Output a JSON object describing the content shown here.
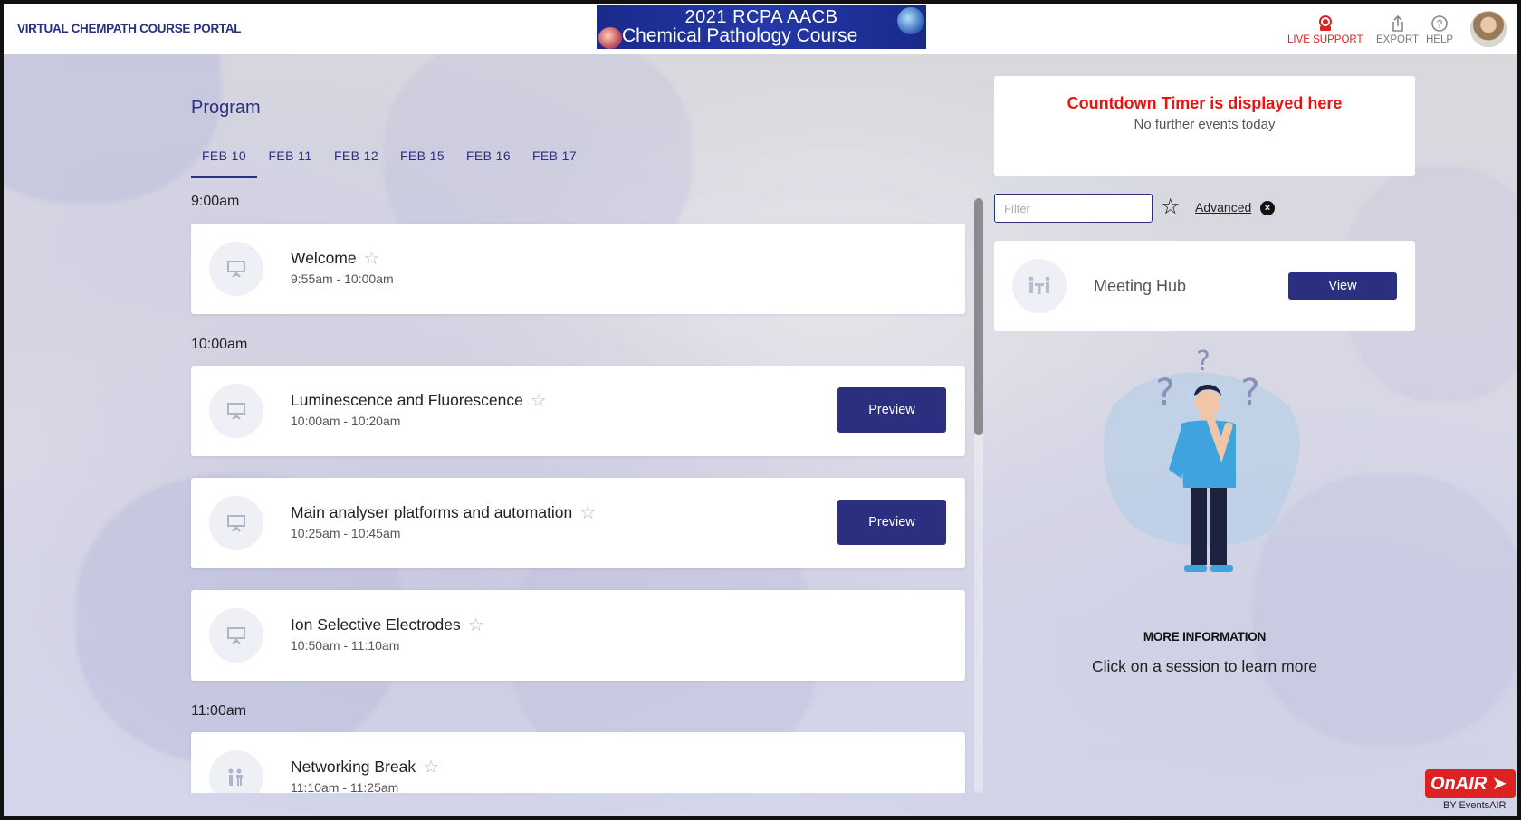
{
  "header": {
    "portal_title": "VIRTUAL CHEMPATH COURSE PORTAL",
    "banner_line1": "2021 RCPA AACB",
    "banner_line2": "Chemical Pathology Course",
    "live_support": "LIVE SUPPORT",
    "export": "EXPORT",
    "help": "HELP"
  },
  "program": {
    "title": "Program",
    "tabs": [
      {
        "label": "FEB 10",
        "active": true
      },
      {
        "label": "FEB 11",
        "active": false
      },
      {
        "label": "FEB 12",
        "active": false
      },
      {
        "label": "FEB 15",
        "active": false
      },
      {
        "label": "FEB 16",
        "active": false
      },
      {
        "label": "FEB 17",
        "active": false
      }
    ],
    "time_groups": [
      "9:00am",
      "10:00am",
      "11:00am"
    ],
    "sessions": [
      {
        "title": "Welcome",
        "times": "9:55am - 10:00am",
        "icon": "presentation-icon",
        "has_preview": false
      },
      {
        "title": "Luminescence and Fluorescence",
        "times": "10:00am - 10:20am",
        "icon": "presentation-icon",
        "has_preview": true
      },
      {
        "title": "Main analyser platforms and automation",
        "times": "10:25am - 10:45am",
        "icon": "presentation-icon",
        "has_preview": true
      },
      {
        "title": "Ion Selective Electrodes",
        "times": "10:50am - 11:10am",
        "icon": "presentation-icon",
        "has_preview": false
      },
      {
        "title": "Networking Break",
        "times": "11:10am - 11:25am",
        "icon": "people-icon",
        "has_preview": false
      }
    ],
    "preview_label": "Preview"
  },
  "countdown": {
    "title": "Countdown Timer is displayed here",
    "subtitle": "No further events today"
  },
  "filter": {
    "placeholder": "Filter",
    "advanced_label": "Advanced"
  },
  "meeting_hub": {
    "title": "Meeting Hub",
    "view_label": "View"
  },
  "more_info": {
    "heading": "MORE INFORMATION",
    "text": "Click on a session to learn more"
  },
  "branding": {
    "logo_text": "OnAIR",
    "by_text": "BY EventsAIR"
  },
  "colors": {
    "primary": "#2a2f80",
    "alert": "#e11111"
  }
}
